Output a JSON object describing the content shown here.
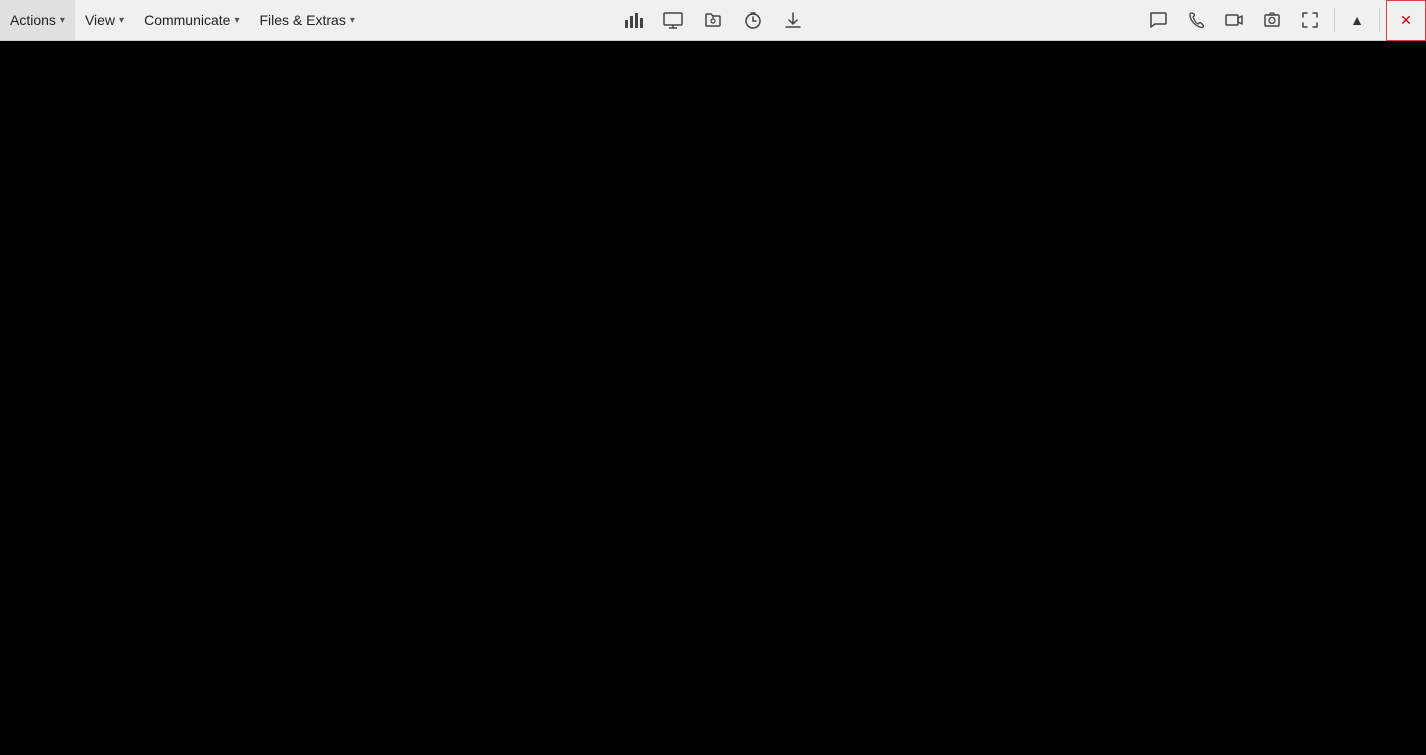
{
  "toolbar": {
    "menus": [
      {
        "id": "actions",
        "label": "Actions",
        "hasChevron": true
      },
      {
        "id": "view",
        "label": "View",
        "hasChevron": true
      },
      {
        "id": "communicate",
        "label": "Communicate",
        "hasChevron": true
      },
      {
        "id": "files-extras",
        "label": "Files & Extras",
        "hasChevron": true
      }
    ],
    "center_icons": [
      {
        "id": "stats",
        "symbol": "📊",
        "title": "Statistics"
      },
      {
        "id": "display",
        "symbol": "🖥",
        "title": "Display"
      },
      {
        "id": "files",
        "symbol": "📂",
        "title": "Files"
      },
      {
        "id": "timer",
        "symbol": "⏱",
        "title": "Timer"
      },
      {
        "id": "download",
        "symbol": "⬇",
        "title": "Download"
      }
    ],
    "right_icons": [
      {
        "id": "chat",
        "symbol": "💬",
        "title": "Chat"
      },
      {
        "id": "phone",
        "symbol": "📞",
        "title": "Phone"
      },
      {
        "id": "video",
        "symbol": "📹",
        "title": "Video"
      },
      {
        "id": "camera",
        "symbol": "📷",
        "title": "Camera/Screenshot"
      },
      {
        "id": "fullscreen",
        "symbol": "⛶",
        "title": "Fullscreen"
      }
    ],
    "up_label": "▲",
    "close_label": "✕"
  },
  "main": {
    "background": "#000000"
  }
}
